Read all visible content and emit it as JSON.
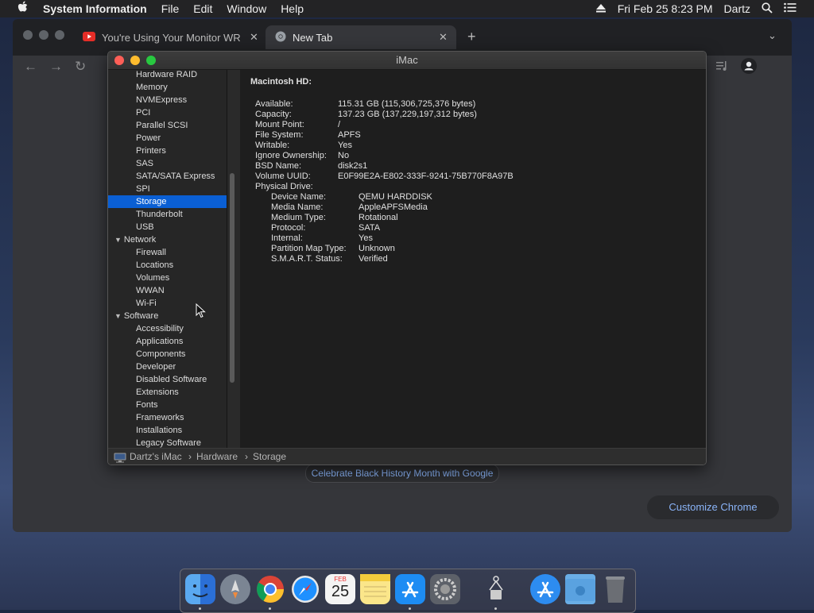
{
  "menubar": {
    "app_name": "System Information",
    "menus": [
      "File",
      "Edit",
      "Window",
      "Help"
    ],
    "datetime": "Fri Feb 25  8:23 PM",
    "user": "Dartz"
  },
  "chrome": {
    "tabs": [
      {
        "title": "You're Using Your Monitor WR",
        "icon": "youtube-icon"
      },
      {
        "title": "New Tab",
        "icon": "chrome-icon"
      }
    ],
    "celebrate_text": "Celebrate Black History Month with Google",
    "customize_label": "Customize Chrome"
  },
  "sysinfo": {
    "title": "iMac",
    "sidebar": [
      {
        "label": "Hardware RAID",
        "level": 1
      },
      {
        "label": "Memory",
        "level": 1
      },
      {
        "label": "NVMExpress",
        "level": 1
      },
      {
        "label": "PCI",
        "level": 1
      },
      {
        "label": "Parallel SCSI",
        "level": 1
      },
      {
        "label": "Power",
        "level": 1
      },
      {
        "label": "Printers",
        "level": 1
      },
      {
        "label": "SAS",
        "level": 1
      },
      {
        "label": "SATA/SATA Express",
        "level": 1
      },
      {
        "label": "SPI",
        "level": 1
      },
      {
        "label": "Storage",
        "level": 1,
        "selected": true
      },
      {
        "label": "Thunderbolt",
        "level": 1
      },
      {
        "label": "USB",
        "level": 1
      },
      {
        "label": "Network",
        "level": 0
      },
      {
        "label": "Firewall",
        "level": 1
      },
      {
        "label": "Locations",
        "level": 1
      },
      {
        "label": "Volumes",
        "level": 1
      },
      {
        "label": "WWAN",
        "level": 1
      },
      {
        "label": "Wi-Fi",
        "level": 1
      },
      {
        "label": "Software",
        "level": 0
      },
      {
        "label": "Accessibility",
        "level": 1
      },
      {
        "label": "Applications",
        "level": 1
      },
      {
        "label": "Components",
        "level": 1
      },
      {
        "label": "Developer",
        "level": 1
      },
      {
        "label": "Disabled Software",
        "level": 1
      },
      {
        "label": "Extensions",
        "level": 1
      },
      {
        "label": "Fonts",
        "level": 1
      },
      {
        "label": "Frameworks",
        "level": 1
      },
      {
        "label": "Installations",
        "level": 1
      },
      {
        "label": "Legacy Software",
        "level": 1
      }
    ],
    "volume_heading": "Macintosh HD:",
    "volume_props": [
      {
        "key": "Available:",
        "value": "115.31 GB (115,306,725,376 bytes)"
      },
      {
        "key": "Capacity:",
        "value": "137.23 GB (137,229,197,312 bytes)"
      },
      {
        "key": "Mount Point:",
        "value": "/"
      },
      {
        "key": "File System:",
        "value": "APFS"
      },
      {
        "key": "Writable:",
        "value": "Yes"
      },
      {
        "key": "Ignore Ownership:",
        "value": "No"
      },
      {
        "key": "BSD Name:",
        "value": "disk2s1"
      },
      {
        "key": "Volume UUID:",
        "value": "E0F99E2A-E802-333F-9241-75B770F8A97B"
      }
    ],
    "physical_drive_label": "Physical Drive:",
    "drive_props": [
      {
        "key": "Device Name:",
        "value": "QEMU HARDDISK"
      },
      {
        "key": "Media Name:",
        "value": "AppleAPFSMedia"
      },
      {
        "key": "Medium Type:",
        "value": "Rotational"
      },
      {
        "key": "Protocol:",
        "value": "SATA"
      },
      {
        "key": "Internal:",
        "value": "Yes"
      },
      {
        "key": "Partition Map Type:",
        "value": "Unknown"
      },
      {
        "key": "S.M.A.R.T. Status:",
        "value": "Verified"
      }
    ],
    "path": {
      "computer": "Dartz's iMac",
      "sep": "›",
      "section": "Hardware",
      "item": "Storage"
    }
  },
  "dock": {
    "calendar_month": "FEB",
    "calendar_day": "25",
    "items": [
      "finder-icon",
      "launchpad-icon",
      "chrome-icon",
      "safari-icon",
      "calendar-icon",
      "notes-icon",
      "app-store-icon",
      "system-preferences-icon",
      "system-information-icon",
      "applications-folder-icon",
      "downloads-folder-icon",
      "trash-icon"
    ]
  },
  "colors": {
    "selection": "#0a5fd4",
    "accent_link": "#8ab4f8"
  }
}
